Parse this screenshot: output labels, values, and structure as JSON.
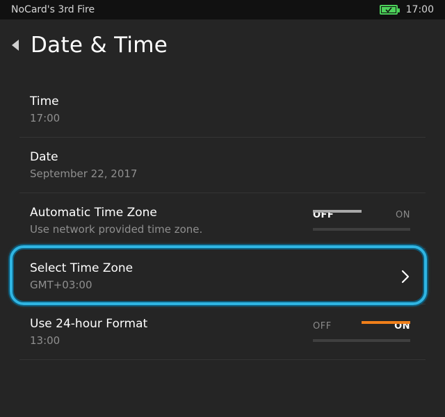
{
  "status_bar": {
    "device_name": "NoCard's 3rd Fire",
    "battery_icon": "battery-charging-icon",
    "battery_color": "#4cd15a",
    "time": "17:00"
  },
  "header": {
    "back_icon": "back-arrow-icon",
    "title": "Date & Time"
  },
  "settings": {
    "time": {
      "label": "Time",
      "value": "17:00"
    },
    "date": {
      "label": "Date",
      "value": "September 22, 2017"
    },
    "auto_time_zone": {
      "label": "Automatic Time Zone",
      "value": "Use network provided time zone.",
      "toggle": {
        "off_label": "OFF",
        "on_label": "ON",
        "state": "off"
      }
    },
    "select_time_zone": {
      "label": "Select Time Zone",
      "value": "GMT+03:00",
      "icon": "chevron-right-icon"
    },
    "format_24h": {
      "label": "Use 24-hour Format",
      "value": "13:00",
      "toggle": {
        "off_label": "OFF",
        "on_label": "ON",
        "state": "on"
      }
    }
  },
  "colors": {
    "background": "#252525",
    "status_bar": "#111111",
    "accent_orange": "#f07f1a",
    "highlight_blue": "#2fb5e3",
    "secondary_text": "#8f8f8f"
  }
}
